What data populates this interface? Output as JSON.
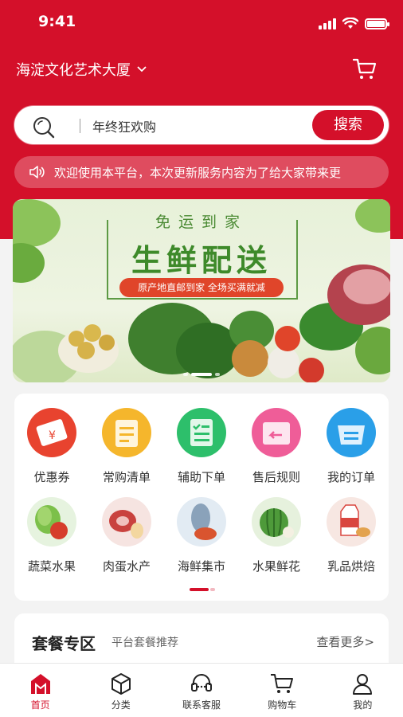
{
  "status_bar": {
    "time": "9:41"
  },
  "header": {
    "location": "海淀文化艺术大厦",
    "cart_icon": "cart-icon"
  },
  "search": {
    "value": "年终狂欢购",
    "button_label": "搜索"
  },
  "notice": {
    "text": "欢迎使用本平台，本次更新服务内容为了给大家带来更"
  },
  "banner": {
    "top_text": "免运到家",
    "main_text": "生鲜配送",
    "tag_text": "原产地直邮到家 全场买满就减"
  },
  "categories": [
    {
      "label": "优惠券",
      "icon": "coupon-icon",
      "color": "#e8432f"
    },
    {
      "label": "常购清单",
      "icon": "list-icon",
      "color": "#f5b62c"
    },
    {
      "label": "辅助下单",
      "icon": "assist-order-icon",
      "color": "#2dbf6b"
    },
    {
      "label": "售后规则",
      "icon": "after-sale-icon",
      "color": "#ef5d98"
    },
    {
      "label": "我的订单",
      "icon": "order-icon",
      "color": "#2a9fe8"
    },
    {
      "label": "蔬菜水果",
      "icon": "vegetable-icon",
      "color": "#7cc04a"
    },
    {
      "label": "肉蛋水产",
      "icon": "meat-icon",
      "color": "#c9423e"
    },
    {
      "label": "海鲜集市",
      "icon": "seafood-icon",
      "color": "#6f8fb0"
    },
    {
      "label": "水果鲜花",
      "icon": "watermelon-icon",
      "color": "#4e9a3a"
    },
    {
      "label": "乳品烘焙",
      "icon": "dairy-icon",
      "color": "#d9463f"
    }
  ],
  "combo": {
    "title": "套餐专区",
    "subtitle": "平台套餐推荐",
    "more": "查看更多>"
  },
  "tabbar": [
    {
      "label": "首页",
      "icon": "home-icon",
      "active": true
    },
    {
      "label": "分类",
      "icon": "category-icon",
      "active": false
    },
    {
      "label": "联系客服",
      "icon": "headset-icon",
      "active": false
    },
    {
      "label": "购物车",
      "icon": "cart-icon",
      "active": false
    },
    {
      "label": "我的",
      "icon": "user-icon",
      "active": false
    }
  ],
  "colors": {
    "brand": "#d4102a",
    "background": "#f3f3f3"
  }
}
